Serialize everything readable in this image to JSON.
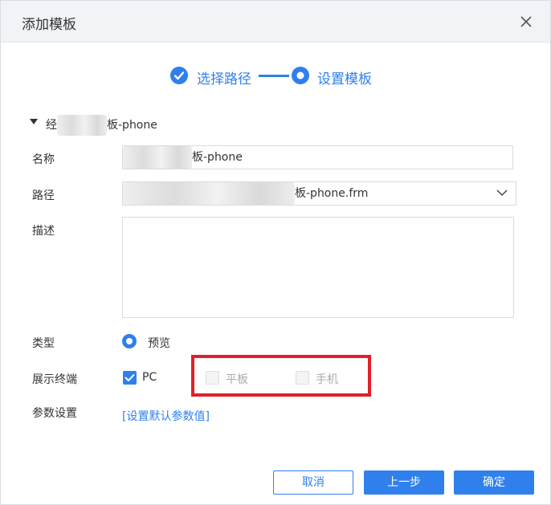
{
  "dialog": {
    "title": "添加模板",
    "close_icon": "close-icon"
  },
  "steps": [
    {
      "label": "选择路径",
      "state": "done"
    },
    {
      "label": "设置模板",
      "state": "active"
    }
  ],
  "section": {
    "prefix": "经",
    "suffix": "板-phone"
  },
  "form": {
    "name_label": "名称",
    "name_value_suffix": "板-phone",
    "path_label": "路径",
    "path_value_suffix": "板-phone.frm",
    "desc_label": "描述",
    "desc_value": "",
    "type_label": "类型",
    "type_option": "预览",
    "terminal_label": "展示终端",
    "terminals": [
      {
        "label": "PC",
        "checked": true,
        "disabled": false
      },
      {
        "label": "平板",
        "checked": false,
        "disabled": true
      },
      {
        "label": "手机",
        "checked": false,
        "disabled": true
      }
    ],
    "params_label": "参数设置",
    "params_link": "[设置默认参数值]"
  },
  "footer": {
    "cancel": "取消",
    "prev": "上一步",
    "confirm": "确定"
  },
  "colors": {
    "accent": "#2f80ed",
    "highlight": "#e0202a"
  }
}
